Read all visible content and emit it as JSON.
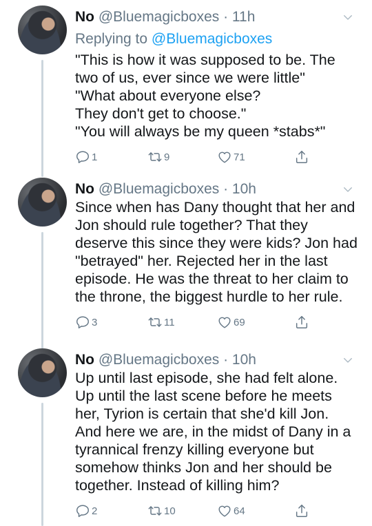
{
  "tweets": [
    {
      "name": "No",
      "handle": "@Bluemagicboxes",
      "time": "· 11h",
      "reply_prefix": "Replying to",
      "reply_handle": "@Bluemagicboxes",
      "lines": [
        "\"This is how it was supposed to be. The",
        "two of us, ever since we were little\"",
        "\"What about everyone else?",
        "They don't get to choose.\"",
        "\"You will always be my queen *stabs*\""
      ],
      "replies": "1",
      "retweets": "9",
      "likes": "71"
    },
    {
      "name": "No",
      "handle": "@Bluemagicboxes",
      "time": "· 10h",
      "lines": [
        "Since when has Dany thought that her and",
        "Jon should rule together? That they",
        "deserve this since they were kids? Jon had",
        "\"betrayed\" her. Rejected her in the last",
        "episode. He was the threat to her claim to",
        "the throne, the biggest hurdle to her rule."
      ],
      "replies": "3",
      "retweets": "11",
      "likes": "69"
    },
    {
      "name": "No",
      "handle": "@Bluemagicboxes",
      "time": "· 10h",
      "lines": [
        "Up until last episode, she had felt alone.",
        "Up until the last scene before he meets",
        "her, Tyrion is certain that she'd kill Jon.",
        "And here we are, in the midst of Dany in a",
        "tyrannical frenzy killing everyone but",
        "somehow thinks Jon and her should be",
        "together. Instead of killing him?"
      ],
      "replies": "2",
      "retweets": "10",
      "likes": "64"
    }
  ],
  "icons": {
    "reply": "reply-icon",
    "retweet": "retweet-icon",
    "like": "heart-icon",
    "share": "share-icon",
    "more": "chevron-down-icon"
  },
  "colors": {
    "link": "#1da1f2",
    "muted": "#657786",
    "thread": "#ccd6dd"
  }
}
